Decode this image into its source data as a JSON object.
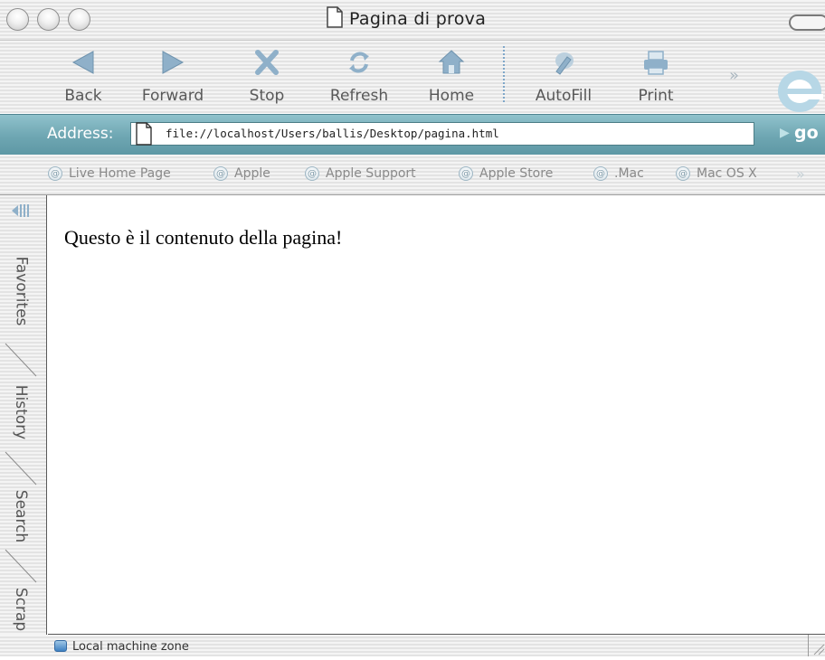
{
  "window": {
    "title": "Pagina di prova"
  },
  "toolbar": {
    "buttons": [
      {
        "label": "Back",
        "icon": "back-arrow-icon"
      },
      {
        "label": "Forward",
        "icon": "forward-arrow-icon"
      },
      {
        "label": "Stop",
        "icon": "stop-x-icon"
      },
      {
        "label": "Refresh",
        "icon": "refresh-icon"
      },
      {
        "label": "Home",
        "icon": "home-icon"
      },
      {
        "label": "AutoFill",
        "icon": "autofill-pen-icon"
      },
      {
        "label": "Print",
        "icon": "printer-icon"
      }
    ],
    "more": "»"
  },
  "address": {
    "label": "Address:",
    "url": "file://localhost/Users/ballis/Desktop/pagina.html",
    "go_label": "go"
  },
  "favorites": {
    "items": [
      "Live Home Page",
      "Apple",
      "Apple Support",
      "Apple Store",
      ".Mac",
      "Mac OS X"
    ],
    "more": "»"
  },
  "sidebar": {
    "tabs": [
      "Favorites",
      "History",
      "Search",
      "Scrap"
    ]
  },
  "page": {
    "content": "Questo è il contenuto della pagina!"
  },
  "status": {
    "zone": "Local machine zone"
  },
  "colors": {
    "address_bar": "#6ea6b2",
    "icon_blue": "#8fb0c9"
  }
}
